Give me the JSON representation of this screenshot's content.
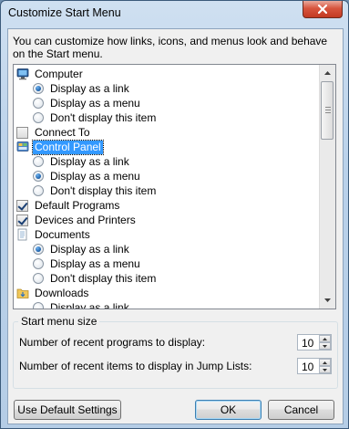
{
  "window": {
    "title": "Customize Start Menu"
  },
  "description": "You can customize how links, icons, and menus look and behave on the Start menu.",
  "tree": [
    {
      "kind": "category",
      "icon": "computer-icon",
      "label": "Computer"
    },
    {
      "kind": "radio",
      "label": "Display as a link",
      "checked": true
    },
    {
      "kind": "radio",
      "label": "Display as a menu",
      "checked": false
    },
    {
      "kind": "radio",
      "label": "Don't display this item",
      "checked": false
    },
    {
      "kind": "checkbox",
      "label": "Connect To",
      "checked": false
    },
    {
      "kind": "category",
      "icon": "control-panel-icon",
      "label": "Control Panel",
      "selected": true
    },
    {
      "kind": "radio",
      "label": "Display as a link",
      "checked": false
    },
    {
      "kind": "radio",
      "label": "Display as a menu",
      "checked": true
    },
    {
      "kind": "radio",
      "label": "Don't display this item",
      "checked": false
    },
    {
      "kind": "checkbox",
      "label": "Default Programs",
      "checked": true
    },
    {
      "kind": "checkbox",
      "label": "Devices and Printers",
      "checked": true
    },
    {
      "kind": "category",
      "icon": "documents-icon",
      "label": "Documents"
    },
    {
      "kind": "radio",
      "label": "Display as a link",
      "checked": true
    },
    {
      "kind": "radio",
      "label": "Display as a menu",
      "checked": false
    },
    {
      "kind": "radio",
      "label": "Don't display this item",
      "checked": false
    },
    {
      "kind": "category",
      "icon": "downloads-icon",
      "label": "Downloads"
    },
    {
      "kind": "radio",
      "label": "Display as a link",
      "checked": false
    }
  ],
  "size_group": {
    "title": "Start menu size",
    "recent_programs_label": "Number of recent programs to display:",
    "recent_programs_value": "10",
    "recent_items_label": "Number of recent items to display in Jump Lists:",
    "recent_items_value": "10"
  },
  "buttons": {
    "defaults": "Use Default Settings",
    "ok": "OK",
    "cancel": "Cancel"
  },
  "colors": {
    "selection": "#3399ff",
    "close": "#c23a22"
  }
}
